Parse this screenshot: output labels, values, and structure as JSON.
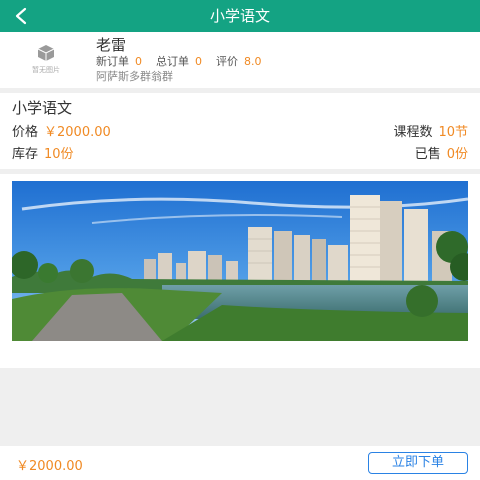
{
  "header": {
    "title": "小学语文"
  },
  "shop": {
    "logo_text": "暂无图片",
    "name": "老雷",
    "new_orders_label": "新订单",
    "new_orders": "0",
    "total_orders_label": "总订单",
    "total_orders": "0",
    "rating_label": "评价",
    "rating": "8.0",
    "address": "阿萨斯多群翁群"
  },
  "course": {
    "title": "小学语文",
    "price_label": "价格",
    "price": "￥2000.00",
    "lessons_label": "课程数",
    "lessons": "10节",
    "stock_label": "库存",
    "stock": "10份",
    "sold_label": "已售",
    "sold": "0份"
  },
  "footer": {
    "price": "￥2000.00",
    "order_button": "立即下单"
  },
  "colors": {
    "header_bg": "#14a383",
    "accent_orange": "#f08a24",
    "button_blue": "#2a82e4"
  }
}
